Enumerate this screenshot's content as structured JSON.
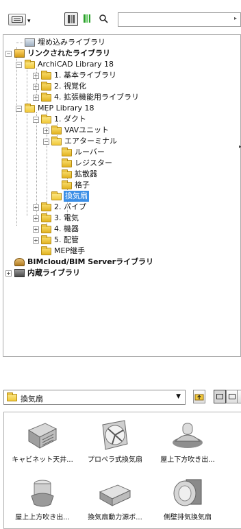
{
  "toolbar": {
    "search": {
      "value": ""
    }
  },
  "tree": {
    "rows": [
      {
        "label": "埋め込みライブラリ"
      },
      {
        "label": "リンクされたライブラリ"
      },
      {
        "label": "ArchiCAD Library 18"
      },
      {
        "label": "1. 基本ライブラリ"
      },
      {
        "label": "2. 視覚化"
      },
      {
        "label": "4. 拡張機能用ライブラリ"
      },
      {
        "label": "MEP Library 18"
      },
      {
        "label": "1. ダクト"
      },
      {
        "label": "VAVユニット"
      },
      {
        "label": "エアターミナル"
      },
      {
        "label": "ルーバー"
      },
      {
        "label": "レジスター"
      },
      {
        "label": "拡散器"
      },
      {
        "label": "格子"
      },
      {
        "label": "換気扇"
      },
      {
        "label": "2. パイプ"
      },
      {
        "label": "3. 電気"
      },
      {
        "label": "4. 機器"
      },
      {
        "label": "5. 配管"
      },
      {
        "label": "MEP継手"
      },
      {
        "label": "BIMcloud/BIM Serverライブラリ"
      },
      {
        "label": "内蔵ライブラリ"
      }
    ],
    "selected": "換気扇",
    "selection_color": "#3a8ee6"
  },
  "browser": {
    "current_folder": "換気扇",
    "view_mode": "large-icons",
    "items": [
      {
        "caption": "キャビネット天井...",
        "icon": "cabinet-ceiling-fan-icon"
      },
      {
        "caption": "プロペラ式換気扇",
        "icon": "propeller-fan-icon"
      },
      {
        "caption": "屋上下方吹き出...",
        "icon": "roof-downblast-fan-icon"
      },
      {
        "caption": "屋上上方吹き出...",
        "icon": "roof-upblast-fan-icon"
      },
      {
        "caption": "換気扇動力源ボ...",
        "icon": "fan-power-box-icon"
      },
      {
        "caption": "側壁排気換気扇",
        "icon": "sidewall-exhaust-fan-icon"
      }
    ]
  }
}
